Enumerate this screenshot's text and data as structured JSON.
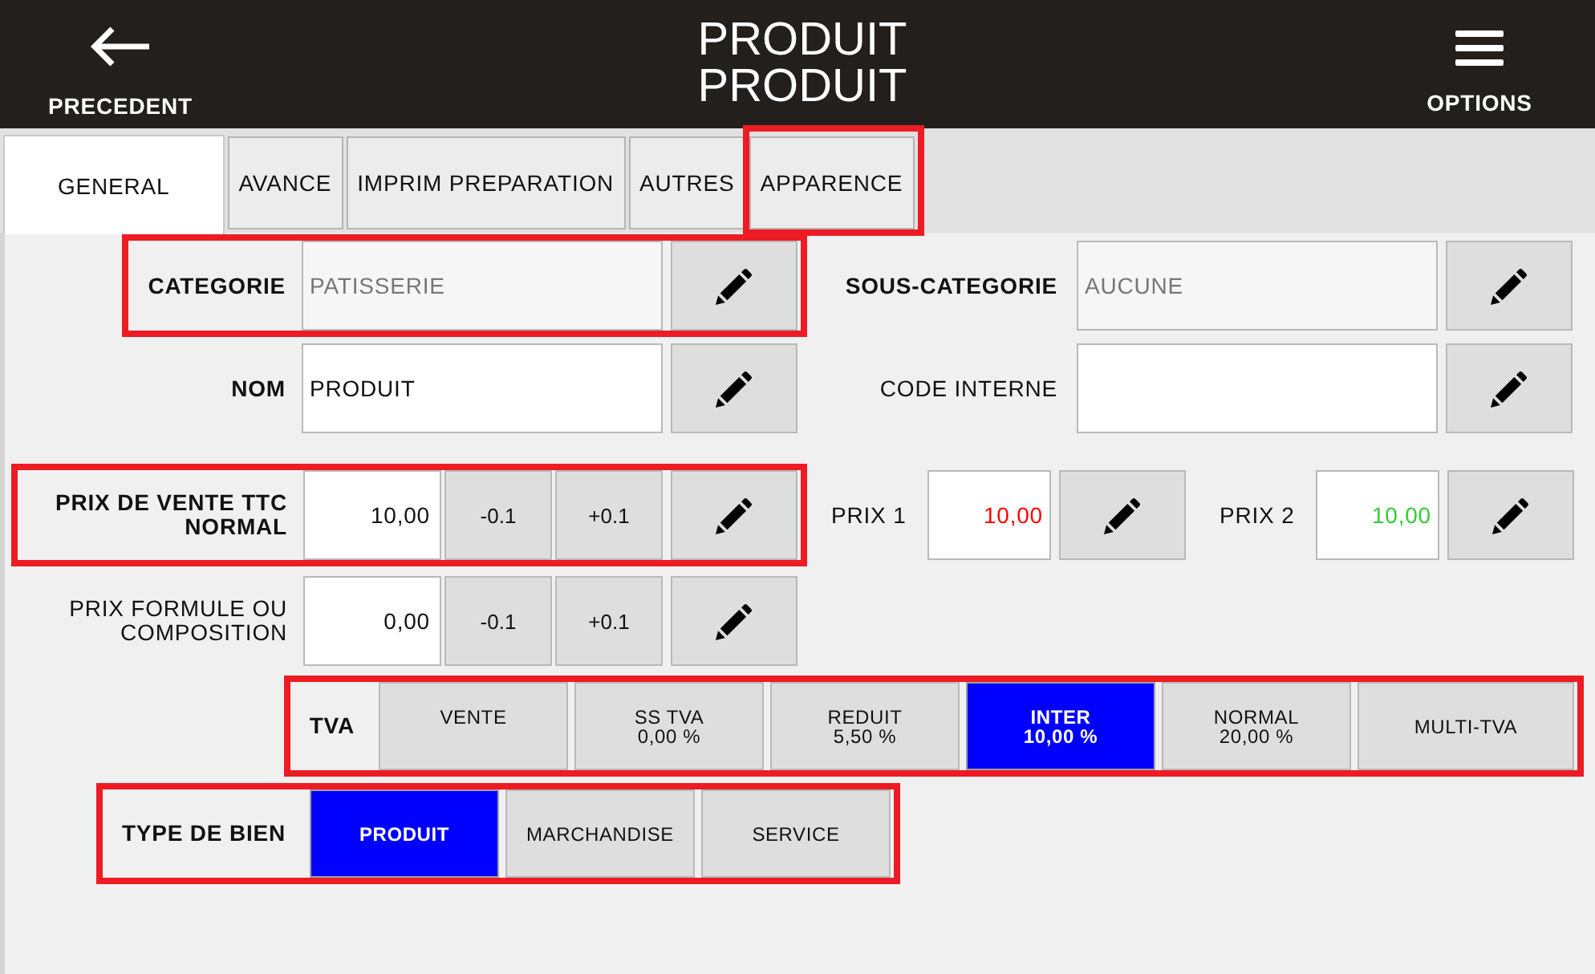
{
  "header": {
    "back": {
      "label": "PRECEDENT"
    },
    "title_lines": [
      "PRODUIT",
      "PRODUIT"
    ],
    "options": {
      "label": "OPTIONS"
    }
  },
  "tabs": [
    {
      "label": "GENERAL",
      "selected": true,
      "highlighted": false
    },
    {
      "label": "AVANCE",
      "selected": false,
      "highlighted": false
    },
    {
      "label": "IMPRIM PREPARATION",
      "selected": false,
      "highlighted": false
    },
    {
      "label": "AUTRES",
      "selected": false,
      "highlighted": false
    },
    {
      "label": "APPARENCE",
      "selected": false,
      "highlighted": true
    }
  ],
  "rows": [
    {
      "kind": "pair",
      "highlighted": true,
      "field": {
        "label": "CATEGORIE",
        "required": true,
        "readonly": true,
        "value": "PATISSERIE"
      },
      "side": {
        "label": "SOUS-CATEGORIE",
        "required": true,
        "readonly": true,
        "value": "AUCUNE"
      }
    },
    {
      "kind": "pair",
      "highlighted": false,
      "field": {
        "label": "NOM",
        "required": true,
        "readonly": false,
        "value": "PRODUIT"
      },
      "side": {
        "label": "CODE INTERNE",
        "required": false
      }
    },
    {
      "kind": "price",
      "highlighted": true,
      "label": "PRIX DE VENTE TTC NORMAL",
      "required": true,
      "value": "10,00",
      "step_down": "-0.1",
      "step_up": "+0.1",
      "extra_prices": [
        {
          "label": "PRIX 1",
          "value": "10,00",
          "color": "#ff0000"
        },
        {
          "label": "PRIX 2",
          "value": "10,00",
          "color": "#33cc33"
        }
      ]
    },
    {
      "kind": "price",
      "highlighted": false,
      "label": "PRIX FORMULE OU COMPOSITION",
      "required": false,
      "value": "0,00",
      "step_down": "-0.1",
      "step_up": "+0.1"
    },
    {
      "kind": "choice",
      "highlighted": true,
      "label": "TVA",
      "required": true,
      "options": [
        {
          "label": "VENTE",
          "selected": false
        },
        {
          "label": "SS TVA",
          "rate": "0,00 %",
          "selected": false
        },
        {
          "label": "REDUIT",
          "rate": "5,50 %",
          "selected": false
        },
        {
          "label": "INTER",
          "rate": "10,00 %",
          "selected": true
        },
        {
          "label": "NORMAL",
          "rate": "20,00 %",
          "selected": false
        }
      ],
      "extra_button": {
        "label": "MULTI-TVA"
      }
    },
    {
      "kind": "choice",
      "highlighted": true,
      "label": "TYPE DE BIEN",
      "required": true,
      "options": [
        {
          "label": "PRODUIT",
          "selected": true
        },
        {
          "label": "MARCHANDISE",
          "selected": false
        },
        {
          "label": "SERVICE",
          "selected": false
        }
      ]
    }
  ]
}
